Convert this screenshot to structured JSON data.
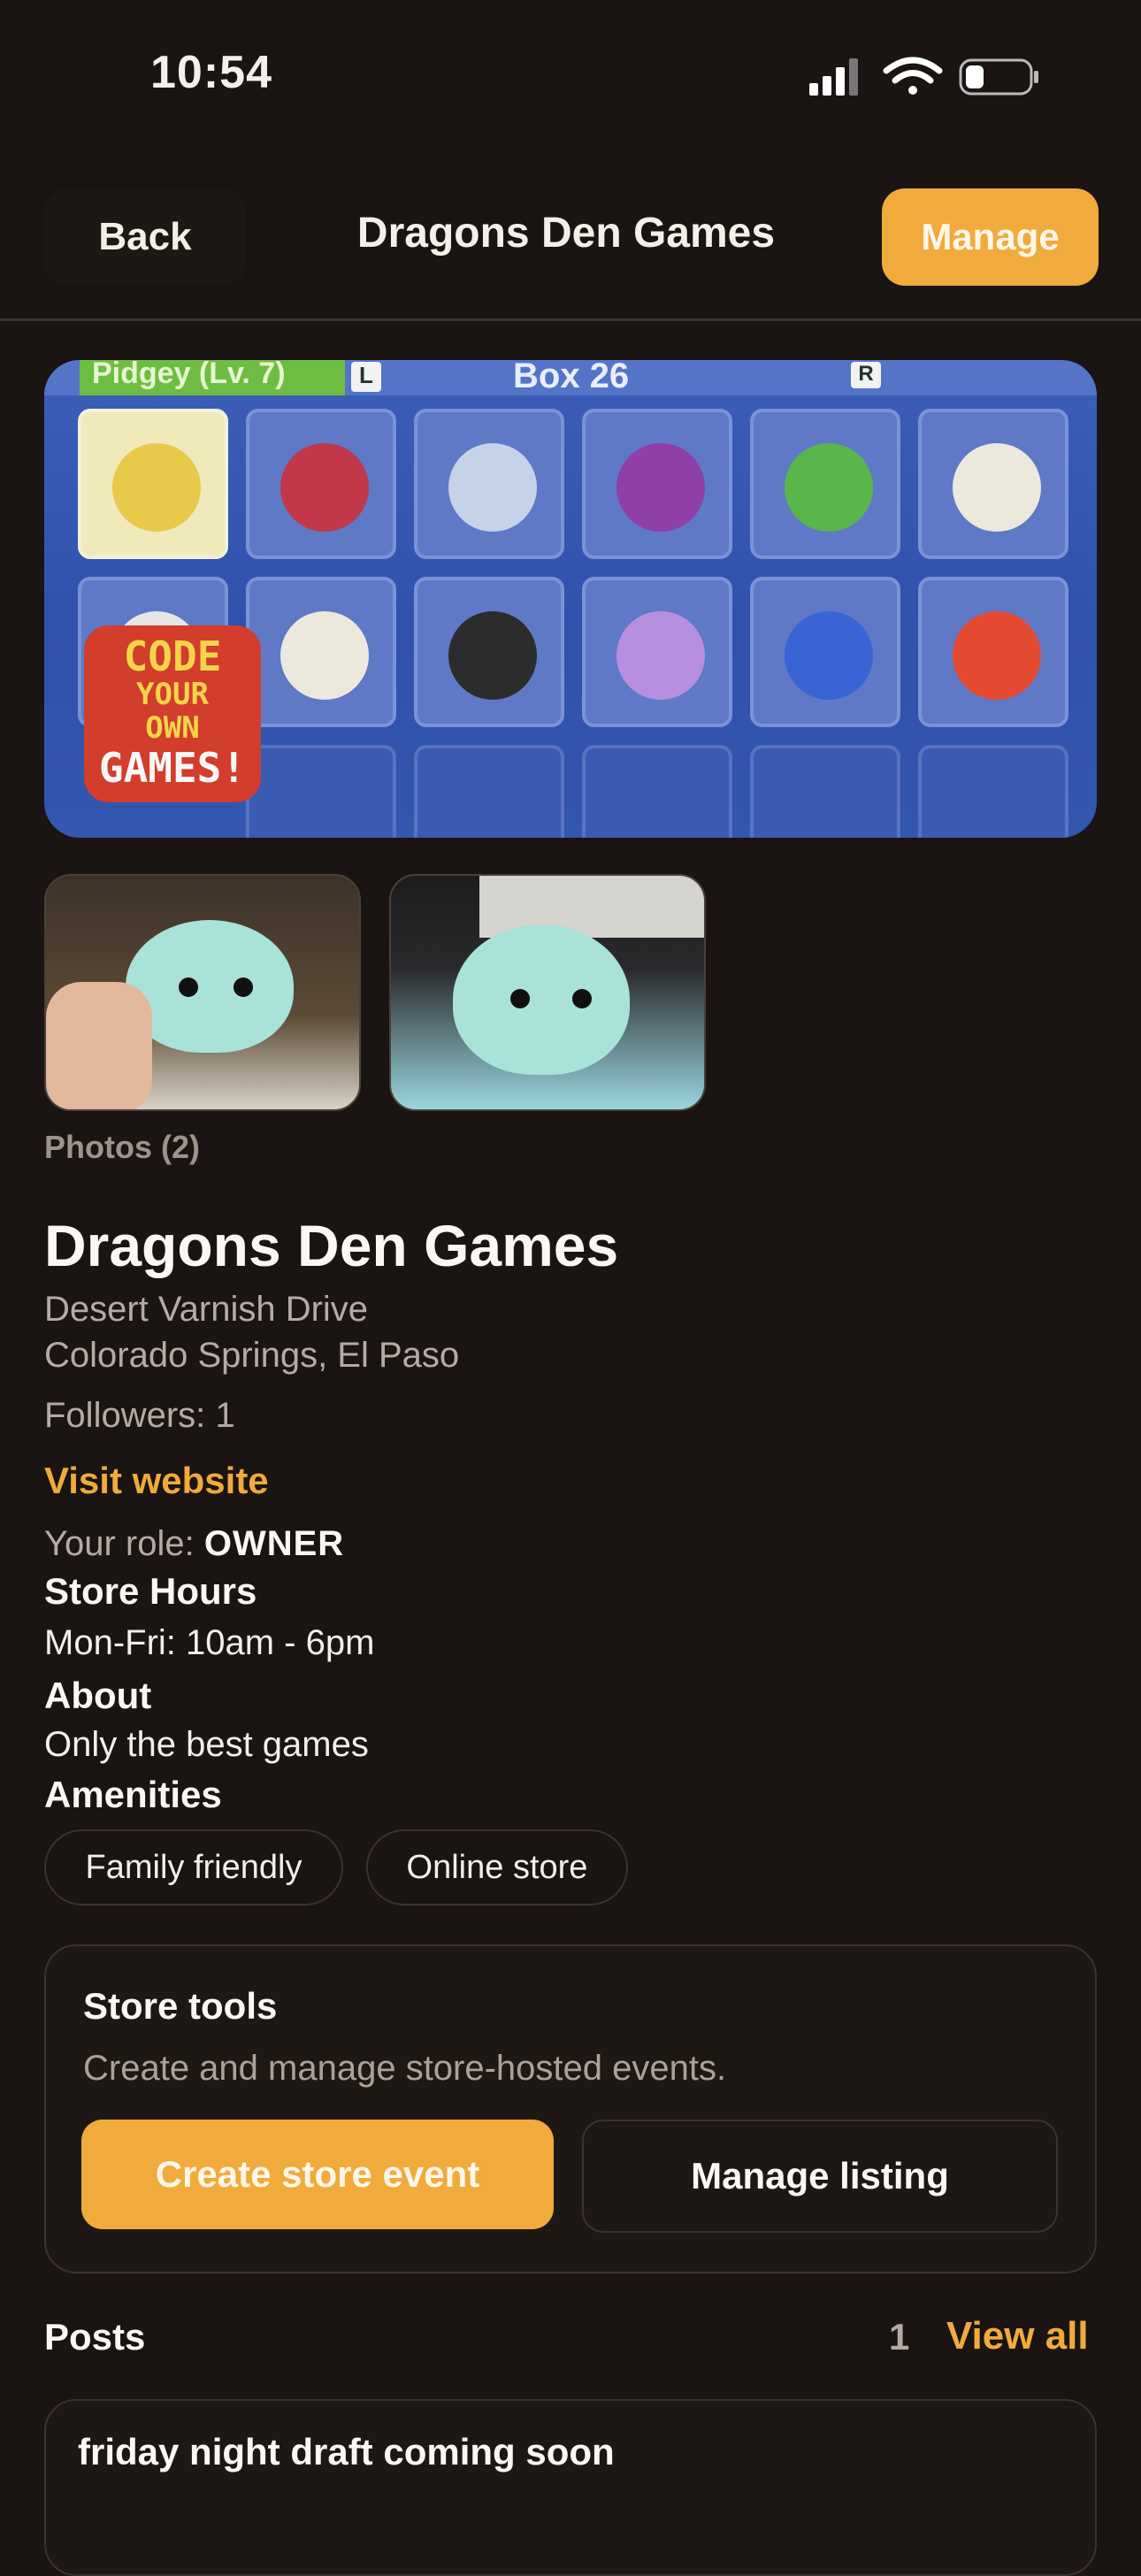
{
  "status_bar": {
    "time": "10:54"
  },
  "nav": {
    "back_label": "Back",
    "title": "Dragons Den Games",
    "manage_label": "Manage"
  },
  "hero": {
    "overlay_tag": "Pidgey (Lv. 7)",
    "left_key": "L",
    "box_label": "Box 26",
    "right_key": "R",
    "cover_lines": [
      "CODE",
      "YOUR",
      "OWN",
      "GAMES!"
    ]
  },
  "photos": {
    "label": "Photos (2)"
  },
  "store": {
    "name": "Dragons Den Games",
    "address_line1": "Desert Varnish Drive",
    "address_line2": "Colorado Springs, El Paso",
    "followers": "Followers: 1",
    "website_link": "Visit website",
    "role_prefix": "Your role: ",
    "role_value": "OWNER",
    "hours_heading": "Store Hours",
    "hours": "Mon-Fri: 10am - 6pm",
    "about_heading": "About",
    "about": "Only the best games",
    "amenities_heading": "Amenities",
    "amenities": [
      "Family friendly",
      "Online store"
    ]
  },
  "store_tools": {
    "title": "Store tools",
    "subtitle": "Create and manage store-hosted events.",
    "create_label": "Create store event",
    "manage_label": "Manage listing"
  },
  "posts": {
    "title": "Posts",
    "count": "1",
    "view_all_label": "View all",
    "items": [
      {
        "title": "friday night draft coming soon"
      }
    ]
  },
  "colors": {
    "background": "#1a1412",
    "accent": "#f1aa3c",
    "card": "#1e1815"
  }
}
